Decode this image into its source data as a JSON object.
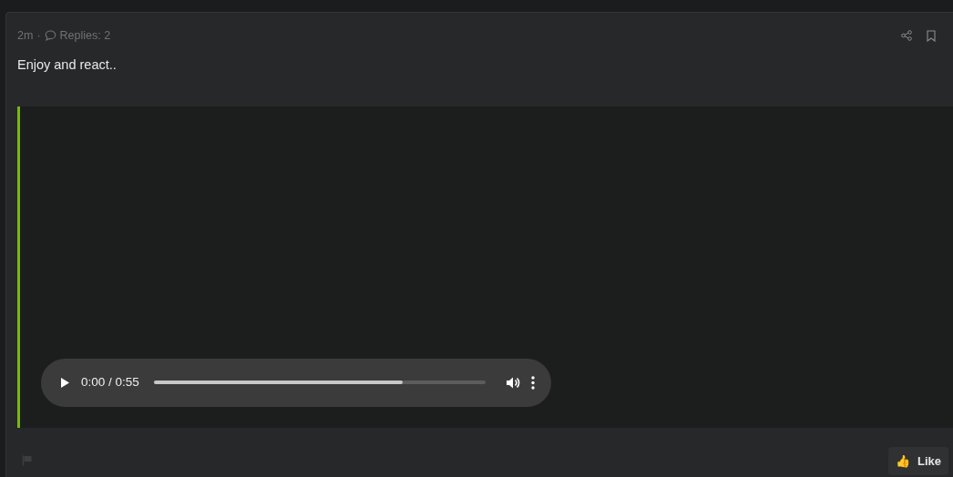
{
  "post": {
    "age": "2m",
    "separator": "·",
    "replies": "Replies: 2",
    "body": "Enjoy and react.."
  },
  "audio": {
    "time": "0:00 / 0:55",
    "progress": {
      "level": 0.75
    }
  },
  "footer": {
    "like_emoji": "👍",
    "like_label": "Like"
  }
}
